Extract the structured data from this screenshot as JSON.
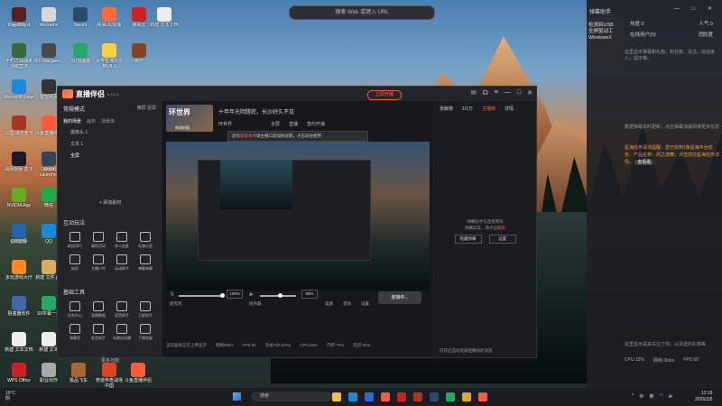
{
  "desktop": {
    "search_placeholder": "搜索 Web 或键入 URL",
    "icons": [
      {
        "label": "回收站",
        "color": "#6aa0d8"
      },
      {
        "label": "WeGame",
        "color": "#d8d8d8"
      },
      {
        "label": "Steam",
        "color": "#2a4a6a"
      },
      {
        "label": "网易UU加速",
        "color": "#ff6a3a"
      },
      {
        "label": "网易云",
        "color": "#cc2222"
      },
      {
        "label": "新建 文本文档",
        "color": "#eeeeee"
      },
      {
        "label": "不朽之战战术训练营法",
        "color": "#3a6a3a"
      },
      {
        "label": "360 Wargami...",
        "color": "#4a4a4a"
      },
      {
        "label": "UU加速器",
        "color": "#22aa66"
      },
      {
        "label": "大学生课外文档V8.0",
        "color": "#ffcc44"
      },
      {
        "label": "雨中",
        "color": "#884422"
      },
      {
        "label": "Microsoft Edge",
        "color": "#1a8ad8"
      },
      {
        "label": "鼠宝网页",
        "color": "#333333"
      },
      {
        "label": "三国:谋定天下",
        "color": "#aa3322"
      },
      {
        "label": "斗鱼直播伴侣",
        "color": "#ff5a3c"
      },
      {
        "label": "战网新版 盒子",
        "color": "#1a1a2a"
      },
      {
        "label": "QQ游戏",
        "color": "#2a6ad8"
      },
      {
        "label": "NVIDIA App",
        "color": "#6aaa22"
      },
      {
        "label": "微信",
        "color": "#22aa44"
      },
      {
        "label": "企鹅助手",
        "color": "#2266cc"
      },
      {
        "label": "QQ",
        "color": "#1a8ad8"
      },
      {
        "label": "多玩游戏大厅",
        "color": "#ff8822"
      },
      {
        "label": "新建 文件.jpg",
        "color": "#ddaa66"
      },
      {
        "label": "阻塞器软件",
        "color": "#4466aa"
      },
      {
        "label": "S9字幕一格",
        "color": "#22aa66"
      },
      {
        "label": "新建 文本文档",
        "color": "#eeeeee"
      },
      {
        "label": "新建 文本",
        "color": "#eeeeee"
      },
      {
        "label": "WPS Office",
        "color": "#cc2222"
      },
      {
        "label": "职业出作",
        "color": "#aaaaaa"
      },
      {
        "label": "极品飞车",
        "color": "#aa6633"
      },
      {
        "label": "奇迹传奇战场中国",
        "color": "#dd4422"
      },
      {
        "label": "斗鱼直播伴侣",
        "color": "#ff5a3c"
      },
      {
        "label": "UU远程",
        "color": "#2266aa"
      },
      {
        "label": "Wosb Launcher",
        "color": "#334455"
      },
      {
        "label": "Dreadmyst",
        "color": "#552222"
      }
    ]
  },
  "app": {
    "name": "直播伴侣",
    "version": "6.3.5.4",
    "live_button": "立即开播",
    "sidebar": {
      "mode": "常规模式",
      "mode_actions": "横屏  竖屏",
      "tabs": [
        "我的场景",
        "画布",
        "场景库"
      ],
      "scenes": [
        "摄像头 1",
        "文本 1",
        "全屏"
      ],
      "add_material": "+ 添加素材",
      "interact_title": "互动玩法",
      "interact_items": [
        "粉丝排行",
        "福利活动",
        "多人连麦",
        "礼物心愿",
        "抽奖",
        "主播口令",
        "动动助手",
        "弹幕弹幕"
      ],
      "tools_title": "基础工具",
      "tools_items": [
        "任务中心",
        "直播数据",
        "语音助手",
        "卫星助手",
        "弹幕秀",
        "发言助手",
        "场景自动播",
        "下播答疑"
      ],
      "more": "更多功能"
    },
    "center": {
      "cover_title": "环世界",
      "cover_sub": "修改封面",
      "stream_title": "十年年光阴蹉跎，长沙好久不见",
      "category": "环世界",
      "info": [
        "全屏",
        "直播",
        "签约开播"
      ],
      "notice_a": "您有",
      "notice_b": "新版本待",
      "notice_c": "请主播口袋加快过期，点击前往使用",
      "mic_pct": "100%",
      "speaker_pct": "50%",
      "labels": [
        "麦克风",
        "扬声器",
        "美颜",
        "音效",
        "设置"
      ],
      "connect_btn": "连接中...",
      "status": [
        "当前画质正在上传显示",
        "网络0kb/s",
        "FPS:60",
        "丢帧:0(0.00%)",
        "CPU:15%",
        "内存:70%",
        "延迟 0ms"
      ]
    },
    "right": {
      "tabs": [
        "贡献榜",
        "1/1万",
        "主播榜",
        "详情"
      ],
      "empty_1": "弹幕助手已连接完毕",
      "empty_2": "弹幕异常，请点击",
      "empty_link": "刷新",
      "btn1": "隐藏弹幕",
      "btn2": "设置",
      "bottom": "可开启自动选择直播间的消息"
    }
  },
  "assistant": {
    "title": "弹幕助手",
    "controls": "— □ ✕",
    "left": [
      "检测到USB",
      "全屏驱动工",
      "WindowsX"
    ],
    "rows": [
      [
        "热度 0",
        "人气 0"
      ],
      [
        "在线用户(0)",
        "消防度"
      ]
    ],
    "msg1": "这里显示弹幕和礼物，粉丝数、关注，欢迎进入，提示等。",
    "msg2": "数据弹幕实时更新，点击弹幕加速阅读更多信息",
    "hl": "星海任务请求提醒：您已收到1条星海平台任务，产品名称：风之游舞，点击前往星海任务详情。",
    "hl_btn": "去看看",
    "bottom": "这里显示是来关注了你，以及送的礼物等",
    "stats": [
      "CPU 15%",
      "网络 0kb/s",
      "FPS 60"
    ]
  },
  "taskbar": {
    "temp": "10°C",
    "weather": "阴",
    "search": "搜索",
    "tray": [
      "^",
      "中",
      "英"
    ],
    "time": "12:18",
    "date": "2026/2/5"
  }
}
